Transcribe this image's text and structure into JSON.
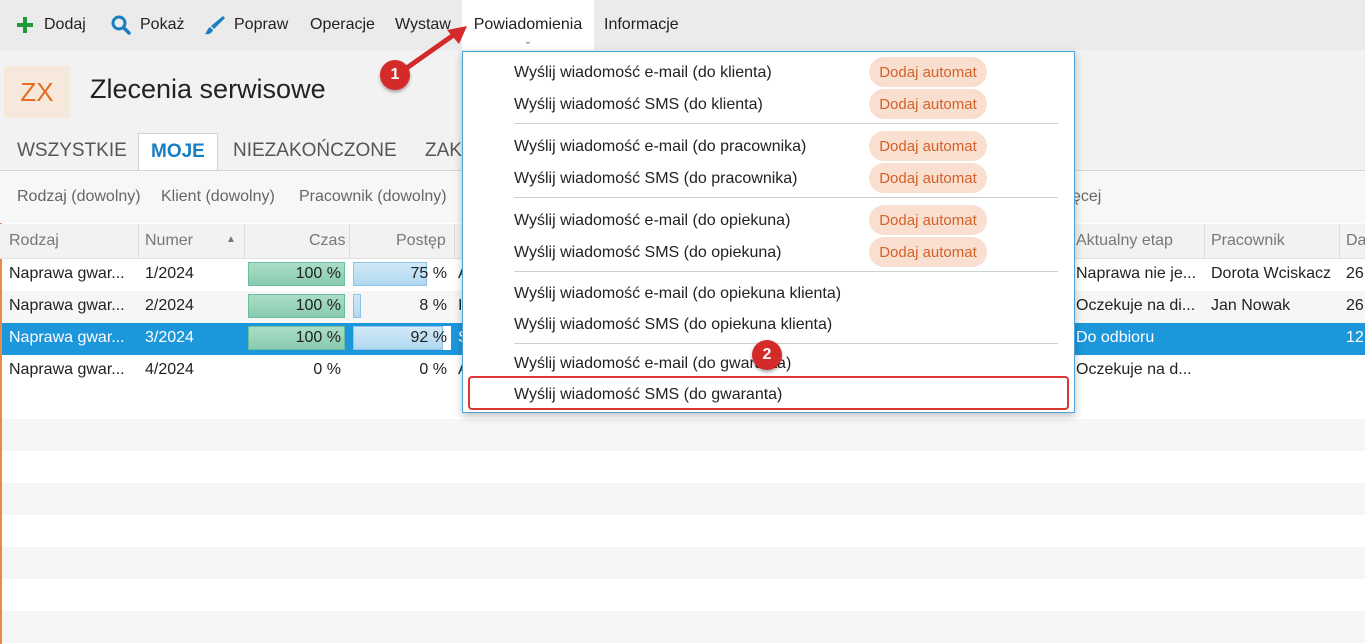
{
  "toolbar": {
    "items": [
      {
        "label": "Dodaj",
        "icon": "plus-icon"
      },
      {
        "label": "Pokaż",
        "icon": "search-icon"
      },
      {
        "label": "Popraw",
        "icon": "brush-icon"
      },
      {
        "label": "Operacje"
      },
      {
        "label": "Wystaw"
      },
      {
        "label": "Powiadomienia"
      },
      {
        "label": "Informacje"
      }
    ]
  },
  "header": {
    "logo_text": "ZX",
    "title": "Zlecenia serwisowe"
  },
  "tabs": [
    "WSZYSTKIE",
    "MOJE",
    "NIEZAKOŃCZONE",
    "ZAKO"
  ],
  "filters": [
    "Rodzaj (dowolny)",
    "Klient (dowolny)",
    "Pracownik (dowolny)",
    "ęcej"
  ],
  "table": {
    "columns": [
      "Rodzaj",
      "Numer",
      "Czas",
      "Postęp",
      "Aktualny etap",
      "Pracownik",
      "Da"
    ],
    "rows": [
      {
        "rodzaj": "Naprawa gwar...",
        "numer": "1/2024",
        "czas": "100 %",
        "czas_value": 100,
        "postep": "75 %",
        "postep_value": 75,
        "etap": "Naprawa nie je...",
        "pracownik": "Dorota Wciskacz",
        "data": "26",
        "hidden": "A"
      },
      {
        "rodzaj": "Naprawa gwar...",
        "numer": "2/2024",
        "czas": "100 %",
        "czas_value": 100,
        "postep": "8 %",
        "postep_value": 8,
        "etap": "Oczekuje na di...",
        "pracownik": "Jan Nowak",
        "data": "26",
        "hidden": "I"
      },
      {
        "rodzaj": "Naprawa gwar...",
        "numer": "3/2024",
        "czas": "100 %",
        "czas_value": 100,
        "postep": "92 %",
        "postep_value": 92,
        "etap": "Do odbioru",
        "pracownik": "",
        "data": "12",
        "hidden": "S"
      },
      {
        "rodzaj": "Naprawa gwar...",
        "numer": "4/2024",
        "czas": "0 %",
        "czas_value": 0,
        "postep": "0 %",
        "postep_value": 0,
        "etap": "Oczekuje na d...",
        "pracownik": "",
        "data": "",
        "hidden": "A"
      }
    ]
  },
  "dropdown": {
    "badge_label": "Dodaj automat",
    "items": [
      {
        "label": "Wyślij wiadomość e-mail (do klienta)",
        "badge": true
      },
      {
        "label": "Wyślij wiadomość SMS (do klienta)",
        "badge": true
      },
      {
        "label": "Wyślij wiadomość e-mail (do pracownika)",
        "badge": true
      },
      {
        "label": "Wyślij wiadomość SMS (do pracownika)",
        "badge": true
      },
      {
        "label": "Wyślij wiadomość e-mail (do opiekuna)",
        "badge": true
      },
      {
        "label": "Wyślij wiadomość SMS (do opiekuna)",
        "badge": true
      },
      {
        "label": "Wyślij wiadomość e-mail (do opiekuna klienta)",
        "badge": false
      },
      {
        "label": "Wyślij wiadomość SMS (do opiekuna klienta)",
        "badge": false
      },
      {
        "label": "Wyślij wiadomość e-mail (do gwaranta)",
        "badge": false
      },
      {
        "label": "Wyślij wiadomość SMS (do gwaranta)",
        "badge": false
      }
    ]
  },
  "markers": [
    "1",
    "2"
  ],
  "colors": {
    "accent": "#1a7fc1",
    "selection": "#1d97dc",
    "badge_bg": "#f9dfcf",
    "badge_text": "#d3612a",
    "marker": "#d42a2a",
    "logo": "#e56d1f"
  }
}
